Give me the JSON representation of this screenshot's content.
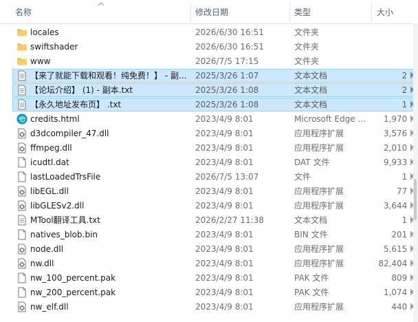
{
  "columns": {
    "name": "名称",
    "date": "修改日期",
    "type": "类型",
    "size": "大小"
  },
  "icons": {
    "folder": "folder-icon",
    "text": "text-document-icon",
    "edge": "edge-html-icon",
    "dll": "dll-gear-icon",
    "file": "blank-file-icon",
    "pak": "pak-file-icon"
  },
  "colors": {
    "selection_fill": "#cce8ff",
    "selection_border": "#99d1ff",
    "folder": "#f4c55f"
  },
  "files": [
    {
      "name": "locales",
      "date": "2026/6/30 16:51",
      "type": "文件夹",
      "size": "",
      "icon": "folder",
      "selected": false
    },
    {
      "name": "swiftshader",
      "date": "2026/6/30 16:51",
      "type": "文件夹",
      "size": "",
      "icon": "folder",
      "selected": false
    },
    {
      "name": "www",
      "date": "2026/7/5 17:15",
      "type": "文件夹",
      "size": "",
      "icon": "folder",
      "selected": false
    },
    {
      "name": "【来了就能下载和观看！纯免费！】 - 副...",
      "date": "2025/3/26 1:07",
      "type": "文本文档",
      "size": "2 K",
      "icon": "text",
      "selected": true
    },
    {
      "name": "【论坛介绍】 (1) - 副本.txt",
      "date": "2025/3/26 1:08",
      "type": "文本文档",
      "size": "2 K",
      "icon": "text",
      "selected": true
    },
    {
      "name": "【永久地址发布页】 .txt",
      "date": "2025/3/26 1:08",
      "type": "文本文档",
      "size": "1 K",
      "icon": "text",
      "selected": true
    },
    {
      "name": "credits.html",
      "date": "2023/4/9 8:01",
      "type": "Microsoft Edge ...",
      "size": "1,970 K",
      "icon": "edge",
      "selected": false
    },
    {
      "name": "d3dcompiler_47.dll",
      "date": "2023/4/9 8:01",
      "type": "应用程序扩展",
      "size": "3,576 K",
      "icon": "dll",
      "selected": false
    },
    {
      "name": "ffmpeg.dll",
      "date": "2023/4/9 8:01",
      "type": "应用程序扩展",
      "size": "2,010 K",
      "icon": "dll",
      "selected": false
    },
    {
      "name": "icudtl.dat",
      "date": "2023/4/9 8:01",
      "type": "DAT 文件",
      "size": "9,933 K",
      "icon": "file",
      "selected": false
    },
    {
      "name": "lastLoadedTrsFile",
      "date": "2026/7/5 13:07",
      "type": "文件",
      "size": "1 K",
      "icon": "file",
      "selected": false
    },
    {
      "name": "libEGL.dll",
      "date": "2023/4/9 8:01",
      "type": "应用程序扩展",
      "size": "77 K",
      "icon": "dll",
      "selected": false
    },
    {
      "name": "libGLESv2.dll",
      "date": "2023/4/9 8:01",
      "type": "应用程序扩展",
      "size": "3,644 K",
      "icon": "dll",
      "selected": false
    },
    {
      "name": "MTool翻译工具.txt",
      "date": "2026/2/27 11:38",
      "type": "文本文档",
      "size": "1 K",
      "icon": "text",
      "selected": false
    },
    {
      "name": "natives_blob.bin",
      "date": "2023/4/9 8:01",
      "type": "BIN 文件",
      "size": "201 K",
      "icon": "file",
      "selected": false
    },
    {
      "name": "node.dll",
      "date": "2023/4/9 8:01",
      "type": "应用程序扩展",
      "size": "5,615 K",
      "icon": "dll",
      "selected": false
    },
    {
      "name": "nw.dll",
      "date": "2023/4/9 8:01",
      "type": "应用程序扩展",
      "size": "82,404 K",
      "icon": "dll",
      "selected": false
    },
    {
      "name": "nw_100_percent.pak",
      "date": "2023/4/9 8:01",
      "type": "PAK 文件",
      "size": "809 K",
      "icon": "pak",
      "selected": false
    },
    {
      "name": "nw_200_percent.pak",
      "date": "2023/4/9 8:01",
      "type": "PAK 文件",
      "size": "1,074 K",
      "icon": "pak",
      "selected": false
    },
    {
      "name": "nw_elf.dll",
      "date": "2023/4/9 8:01",
      "type": "应用程序扩展",
      "size": "440 K",
      "icon": "dll",
      "selected": false
    }
  ]
}
